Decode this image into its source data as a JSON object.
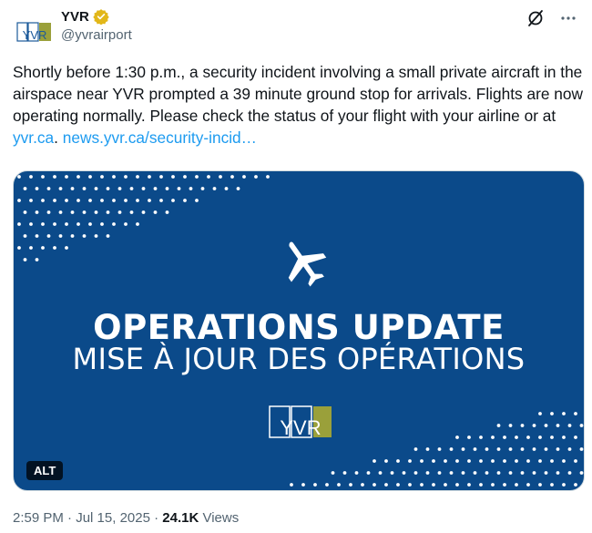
{
  "account": {
    "display_name": "YVR",
    "handle": "@yvrairport",
    "avatar_logo_text": "YVR",
    "verified": true,
    "badge_color": "#e2b719"
  },
  "icons": {
    "grok": "grok-icon",
    "more": "more-icon"
  },
  "tweet": {
    "text_main": "Shortly before 1:30 p.m., a security incident involving a small private aircraft in the airspace near YVR prompted a 39 minute ground stop for arrivals. Flights are now operating normally. Please check the status of your flight with your airline or at ",
    "link1": "yvr.ca",
    "text_mid": ". ",
    "link2": "news.yvr.ca/security-incid…"
  },
  "media": {
    "title": "OPERATIONS UPDATE",
    "subtitle": "MISE À JOUR DES OPÉRATIONS",
    "logo_text": "YVR",
    "alt_label": "ALT",
    "background_color": "#0b4a8a",
    "logo_accent_color": "#9aa03a"
  },
  "meta": {
    "time": "2:59 PM",
    "sep1": " · ",
    "date": "Jul 15, 2025",
    "sep2": " · ",
    "views_count": "24.1K",
    "views_label": " Views"
  },
  "colors": {
    "link": "#1d9bf0",
    "text": "#0f1419",
    "muted": "#536471"
  }
}
